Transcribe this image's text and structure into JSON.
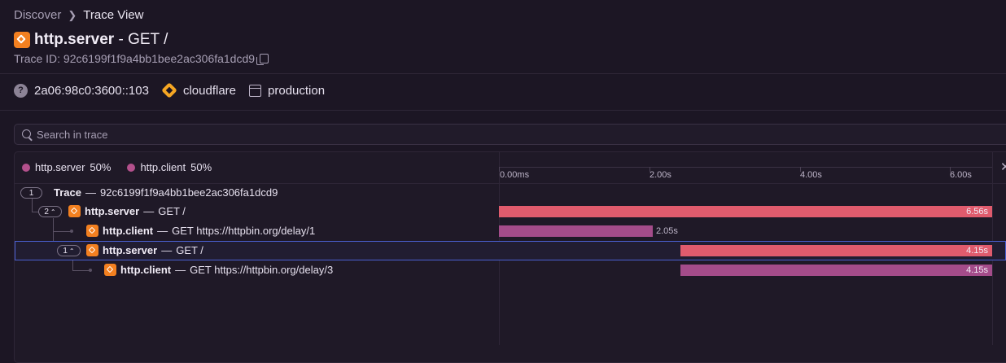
{
  "breadcrumb": {
    "root": "Discover",
    "current": "Trace View"
  },
  "header": {
    "title_bold": "http.server",
    "title_rest": " - GET /",
    "trace_id_label": "Trace ID: 92c6199f1f9a4bb1bee2ac306fa1dcd9"
  },
  "tags": {
    "ip": "2a06:98c0:3600::103",
    "provider": "cloudflare",
    "environment": "production"
  },
  "search": {
    "placeholder": "Search in trace"
  },
  "legend": [
    {
      "label": "http.server",
      "pct": "50%",
      "color": "#b3508c"
    },
    {
      "label": "http.client",
      "pct": "50%",
      "color": "#b3508c"
    }
  ],
  "axis": {
    "ticks": [
      "0.00ms",
      "2.00s",
      "4.00s",
      "6.00s"
    ]
  },
  "rows": [
    {
      "badge": "1",
      "op": "Trace",
      "desc": "92c6199f1f9a4bb1bee2ac306fa1dcd9"
    },
    {
      "badge": "2",
      "op": "http.server",
      "desc": "GET /",
      "duration": "6.56s",
      "color": "#e05b6d"
    },
    {
      "op": "http.client",
      "desc": "GET https://httpbin.org/delay/1",
      "duration": "2.05s",
      "color": "#a44c8a"
    },
    {
      "badge": "1",
      "op": "http.server",
      "desc": "GET /",
      "duration": "4.15s",
      "color": "#e05b6d"
    },
    {
      "op": "http.client",
      "desc": "GET https://httpbin.org/delay/3",
      "duration": "4.15s",
      "color": "#a44c8a"
    }
  ],
  "separator": "—"
}
